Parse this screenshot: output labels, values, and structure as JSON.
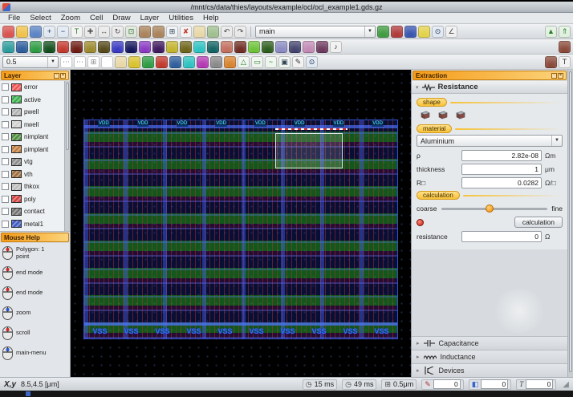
{
  "window": {
    "title": "/mnt/cs/data/thies/layouts/example/ocl/ocl_example1.gds.gz"
  },
  "menu": {
    "items": [
      "File",
      "Select",
      "Zoom",
      "Cell",
      "Draw",
      "Layer",
      "Utilities",
      "Help"
    ]
  },
  "toolbars": {
    "cell_combo": {
      "value": "main"
    },
    "grid_combo": {
      "value": "0.5"
    },
    "row1_left": [
      {
        "name": "new-layout-icon",
        "glyph": "",
        "bg": "#d9534f"
      },
      {
        "name": "open-layout-icon",
        "glyph": "",
        "bg": "#f0c24b"
      },
      {
        "name": "save-layout-icon",
        "glyph": "",
        "bg": "#5b84c4"
      },
      {
        "name": "zoom-in-icon",
        "glyph": "+",
        "bg": "#dfe8f2",
        "fg": "#223355"
      },
      {
        "name": "zoom-out-icon",
        "glyph": "−",
        "bg": "#dfe8f2",
        "fg": "#223355"
      },
      {
        "name": "text-tool-icon",
        "glyph": "T",
        "bg": "#f2f2f2",
        "fg": "#2a7a2a"
      },
      {
        "name": "move-tool-icon",
        "glyph": "✚",
        "bg": "#e8e8e8",
        "fg": "#555555"
      },
      {
        "name": "stretch-tool-icon",
        "glyph": "↔",
        "bg": "#e8e8e8",
        "fg": "#555555"
      },
      {
        "name": "rotate-tool-icon",
        "glyph": "↻",
        "bg": "#e8e8e8",
        "fg": "#555555"
      },
      {
        "name": "copy-tool-icon",
        "glyph": "⊡",
        "bg": "#dce6d8",
        "fg": "#336633"
      },
      {
        "name": "library-icon",
        "glyph": "",
        "bg": "#a9835b"
      },
      {
        "name": "instance-icon",
        "glyph": "",
        "bg": "#a9835b"
      },
      {
        "name": "array-icon",
        "glyph": "⊞",
        "bg": "#eef2f5",
        "fg": "#334455"
      },
      {
        "name": "delete-icon",
        "glyph": "✘",
        "bg": "#f2f2f2",
        "fg": "#c0392b"
      },
      {
        "name": "ruler-icon",
        "glyph": "",
        "bg": "#e8d8a8"
      },
      {
        "name": "snap-icon",
        "glyph": "",
        "bg": "#9fbf8f"
      },
      {
        "name": "undo-icon",
        "glyph": "↶",
        "bg": "#e8e8e8",
        "fg": "#444444"
      },
      {
        "name": "redo-icon",
        "glyph": "↷",
        "bg": "#e8e8e8",
        "fg": "#444444"
      }
    ],
    "row1_right": [
      {
        "name": "fill-green-icon",
        "glyph": "",
        "bg": "#3f9b3f"
      },
      {
        "name": "fill-red-icon",
        "glyph": "",
        "bg": "#b03a3a"
      },
      {
        "name": "fill-blue-icon",
        "glyph": "",
        "bg": "#3a56b0"
      },
      {
        "name": "highlight-icon",
        "glyph": "",
        "bg": "#e3d24b"
      },
      {
        "name": "zoom-select-icon",
        "glyph": "⊙",
        "bg": "#dfe8f2",
        "fg": "#223355"
      },
      {
        "name": "measure-icon",
        "glyph": "∠",
        "bg": "#f0f0f0",
        "fg": "#444444"
      }
    ],
    "row1_end": [
      {
        "name": "up-hierarchy-icon",
        "glyph": "▲",
        "bg": "#dff0df",
        "fg": "#2a7a2a"
      },
      {
        "name": "top-hierarchy-icon",
        "glyph": "⇑",
        "bg": "#dff0df",
        "fg": "#2a7a2a"
      }
    ],
    "row2": [
      {
        "name": "teal-style-icon",
        "bg": "#2e9c9c"
      },
      {
        "name": "blue-style-icon",
        "bg": "#2e5e9c"
      },
      {
        "name": "green-style-icon",
        "bg": "#2e9c44"
      },
      {
        "name": "darkgreen-style-icon",
        "bg": "#14501e"
      },
      {
        "name": "red-style-icon",
        "bg": "#c23a2e"
      },
      {
        "name": "darkred-style-icon",
        "bg": "#6e1e14"
      },
      {
        "name": "olive-style-icon",
        "bg": "#9c8a2e"
      },
      {
        "name": "darkolive-style-icon",
        "bg": "#55491a"
      },
      {
        "name": "royal-style-icon",
        "bg": "#3a3ac2"
      },
      {
        "name": "navy-style-icon",
        "bg": "#17175e"
      },
      {
        "name": "purple-style-icon",
        "bg": "#8a3ac2"
      },
      {
        "name": "darkpurple-style-icon",
        "bg": "#3f1a5e"
      },
      {
        "name": "yellow-style-icon",
        "bg": "#c2b42e"
      },
      {
        "name": "mustard-style-icon",
        "bg": "#6e641a"
      },
      {
        "name": "cyan-style-icon",
        "bg": "#2ec2c2"
      },
      {
        "name": "darkcyan-style-icon",
        "bg": "#156363"
      },
      {
        "name": "salmon-style-icon",
        "bg": "#c26e5e"
      },
      {
        "name": "maroon-style-icon",
        "bg": "#702e24"
      },
      {
        "name": "lime-style-icon",
        "bg": "#6ec23a"
      },
      {
        "name": "forest-style-icon",
        "bg": "#2e5e1e"
      },
      {
        "name": "lavender-style-icon",
        "bg": "#8a8ac2"
      },
      {
        "name": "slate-style-icon",
        "bg": "#44446e"
      },
      {
        "name": "pink-style-icon",
        "bg": "#c28ab4"
      },
      {
        "name": "plum-style-icon",
        "bg": "#6e3a5e"
      },
      {
        "name": "note-icon",
        "glyph": "♪",
        "bg": "#f0f0f0",
        "fg": "#333333"
      }
    ],
    "row2_end": [
      {
        "name": "cube-icon",
        "bg": "#8a4a3a"
      }
    ],
    "row3": [
      {
        "name": "grid-dots-icon",
        "glyph": "⋯",
        "bg": "#ffffff",
        "fg": "#888888"
      },
      {
        "name": "grid-dots-fine-icon",
        "glyph": "⋯",
        "bg": "#ffffff",
        "fg": "#888888"
      },
      {
        "name": "grid-lines-icon",
        "glyph": "⊞",
        "bg": "#ffffff",
        "fg": "#888888"
      },
      {
        "name": "grid-off-icon",
        "glyph": "",
        "bg": "#ffffff"
      },
      {
        "name": "ruler-horizontal-icon",
        "glyph": "",
        "bg": "#e8d8a8"
      },
      {
        "name": "swatch-yellow-icon",
        "bg": "#d8c22e"
      },
      {
        "name": "swatch-green-icon",
        "bg": "#2e9c44"
      },
      {
        "name": "swatch-red-icon",
        "bg": "#c23a2e"
      },
      {
        "name": "swatch-blue-icon",
        "bg": "#2e5e9c"
      },
      {
        "name": "swatch-cyan-icon",
        "bg": "#2ec2c2"
      },
      {
        "name": "swatch-magenta-icon",
        "bg": "#b43ab4"
      },
      {
        "name": "swatch-gray-icon",
        "bg": "#8a8a8a"
      },
      {
        "name": "swatch-orange-icon",
        "bg": "#d8832e"
      },
      {
        "name": "draw-polygon-icon",
        "glyph": "△",
        "bg": "#eef5ee",
        "fg": "#2a7a2a"
      },
      {
        "name": "draw-rect-icon",
        "glyph": "▭",
        "bg": "#eef5ee",
        "fg": "#2a7a2a"
      },
      {
        "name": "draw-wire-icon",
        "glyph": "~",
        "bg": "#eef5ee",
        "fg": "#2a7a2a"
      },
      {
        "name": "draw-via-icon",
        "glyph": "▣",
        "bg": "#eef5ee",
        "fg": "#334455"
      },
      {
        "name": "edit-icon",
        "glyph": "✎",
        "bg": "#f2f2f2",
        "fg": "#333333"
      },
      {
        "name": "zoom-window-icon",
        "glyph": "⊙",
        "bg": "#dfe8f2",
        "fg": "#223355"
      }
    ],
    "row3_end": [
      {
        "name": "cube-alt-icon",
        "bg": "#8a4a3a"
      },
      {
        "name": "text-label-icon",
        "glyph": "T",
        "bg": "#f2f2f2",
        "fg": "#333333"
      }
    ]
  },
  "layer_panel": {
    "title": "Layer",
    "layers": [
      {
        "name": "error",
        "color": "#f05050"
      },
      {
        "name": "active",
        "color": "#35b04a"
      },
      {
        "name": "pwell",
        "color": "#b0b0b0"
      },
      {
        "name": "nwell",
        "color": "#d0d0d0"
      },
      {
        "name": "nimplant",
        "color": "#4a8a3a"
      },
      {
        "name": "pimplant",
        "color": "#c07a3a"
      },
      {
        "name": "vtg",
        "color": "#8a8a8a"
      },
      {
        "name": "vth",
        "color": "#9a6a3a"
      },
      {
        "name": "thkox",
        "color": "#bcbcbc"
      },
      {
        "name": "poly",
        "color": "#d04040"
      },
      {
        "name": "contact",
        "color": "#707070"
      },
      {
        "name": "metal1",
        "color": "#3a56c0"
      }
    ]
  },
  "mouse_help": {
    "title": "Mouse Help",
    "items": [
      {
        "label": "Polygon: 1 point",
        "btn": "#cc2a2a"
      },
      {
        "label": "end mode",
        "btn": "#cc2a2a"
      },
      {
        "label": "end mode",
        "btn": "#cc2a2a"
      },
      {
        "label": "zoom",
        "btn": "#2a55cc"
      },
      {
        "label": "scroll",
        "btn": "#cc2a2a"
      },
      {
        "label": "main-menu",
        "btn": "#2a55cc"
      }
    ]
  },
  "canvas": {
    "top_labels": [
      "VDD",
      "VDD",
      "VDD",
      "VDD",
      "VDD",
      "VDD",
      "VDD",
      "VDD"
    ],
    "bottom_labels": [
      "VSS",
      "VSS",
      "VSS",
      "VSS",
      "VSS",
      "VSS",
      "VSS",
      "VSS",
      "VSS",
      "VSS"
    ]
  },
  "extraction": {
    "title": "Extraction",
    "resistance": {
      "title": "Resistance",
      "shape_label": "shape",
      "material_label": "material",
      "material_value": "Aluminium",
      "rho_label": "ρ",
      "rho_value": "2.82e-08",
      "rho_unit": "Ωm",
      "thickness_label": "thickness",
      "thickness_value": "1",
      "thickness_unit": "μm",
      "rsq_label": "R□",
      "rsq_value": "0.0282",
      "rsq_unit": "Ω/□",
      "calculation_label": "calculation",
      "coarse_label": "coarse",
      "fine_label": "fine",
      "calculate_button": "calculation",
      "resistance_label": "resistance",
      "resistance_value": "0",
      "resistance_unit": "Ω"
    },
    "sections": [
      "Capacitance",
      "Inductance",
      "Devices"
    ]
  },
  "status_bar": {
    "coord_label": "X,y",
    "coords": "8.5,4.5 [μm]",
    "time1": "15 ms",
    "time2": "49 ms",
    "grid": "0.5μm",
    "field1": "0",
    "field2": "0",
    "field3": "0"
  },
  "colors": {
    "accent_orange": "#f59b18",
    "metal_blue": "#3a56c0"
  }
}
